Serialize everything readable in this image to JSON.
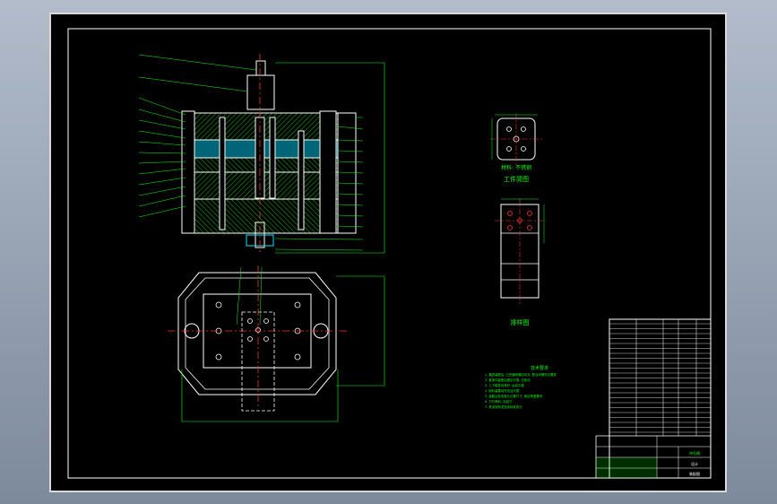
{
  "drawing": {
    "views": {
      "workpiece_caption": "工件简图",
      "material_note": "材料: 不锈钢",
      "strip_caption": "排样图"
    },
    "notes": {
      "title": "技术要求",
      "lines": [
        "1. 模具装配后, 凸凹模间隙应均匀, 配合间隙符合要求",
        "2. 各零件装配后固定可靠, 无松动",
        "3. 上下模导向良好, 运动平稳",
        "4. 卸料装置动作灵活可靠",
        "5. 装配后检查各孔位置尺寸, 保证精度要求",
        "6. 刃口锋利, 无崩刃",
        "7. 其余按有关技术标准执行"
      ]
    },
    "title_block": {
      "part_name": "冲孔模",
      "school": "设计",
      "drawing_no": "装配图"
    }
  },
  "colors": {
    "sheet": "#000000",
    "frame": "#ffffff",
    "green": "#00ff00",
    "red": "#ff3030",
    "cyan": "#00e5ff",
    "grey": "#c0c0c0"
  }
}
